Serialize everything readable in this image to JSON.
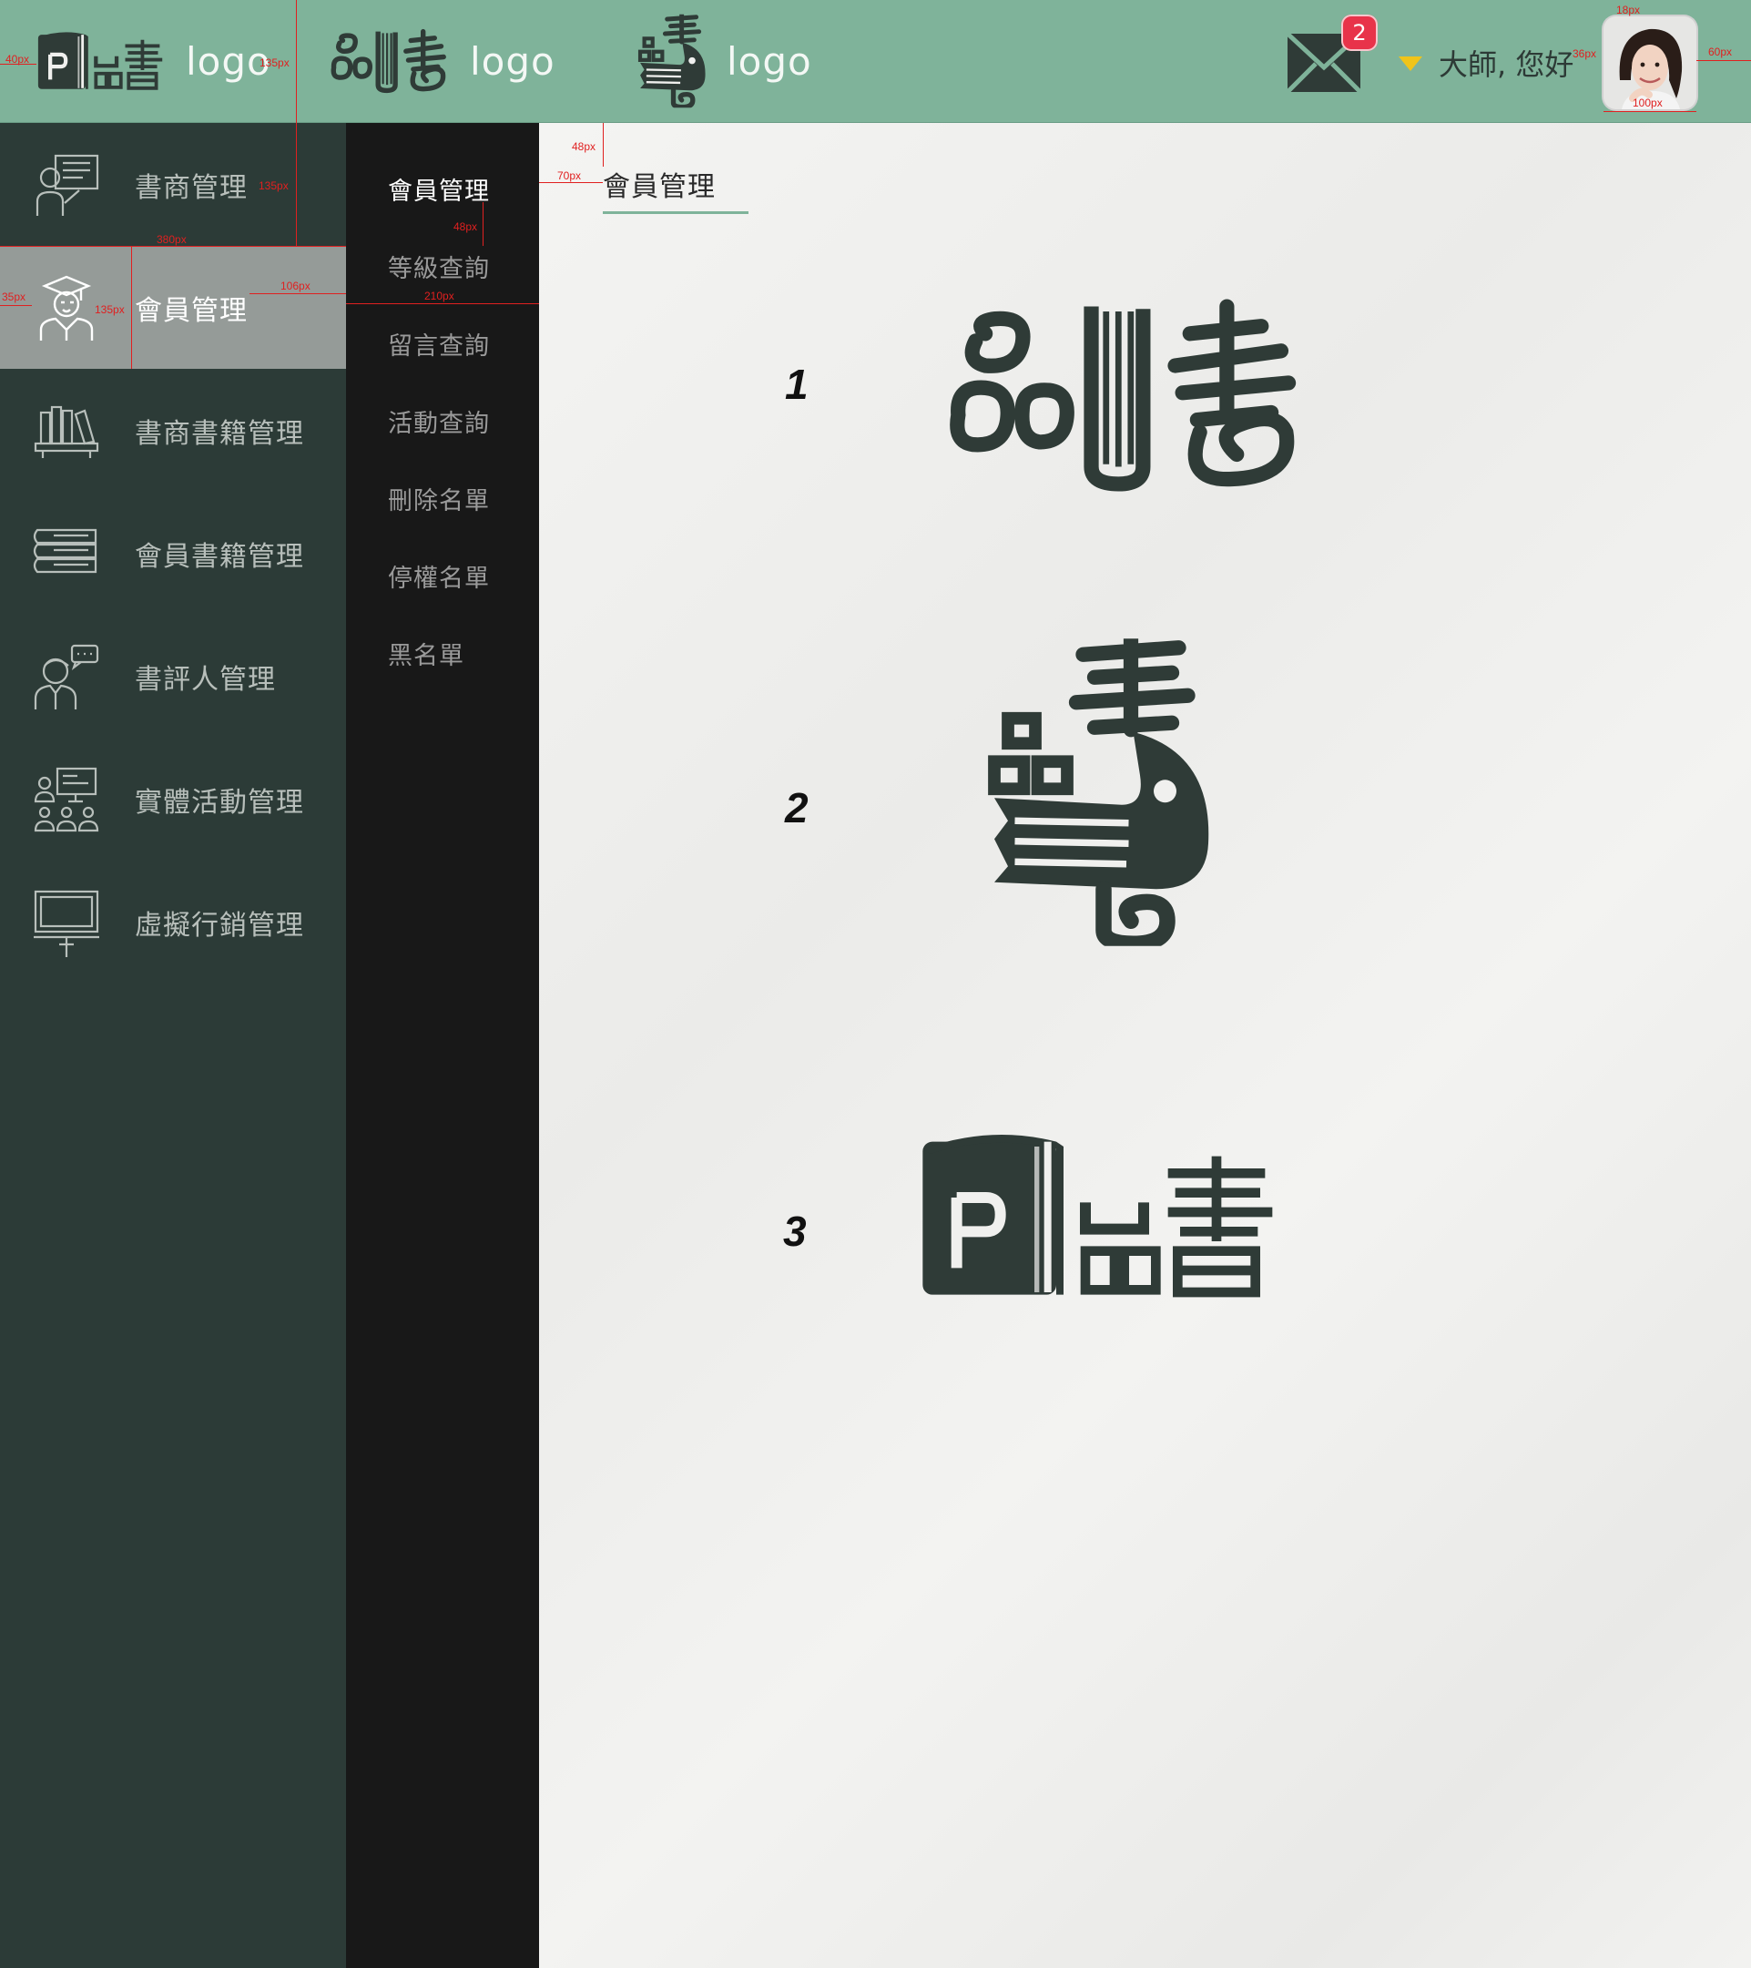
{
  "header": {
    "logos": [
      {
        "icon": "book-p-pin-shu-logo-icon",
        "text": "logo"
      },
      {
        "icon": "pin-book-shu-logo-icon",
        "text": "logo"
      },
      {
        "icon": "bird-shu-logo-icon",
        "text": "logo"
      }
    ],
    "mail_icon": "mail-icon",
    "unread_count": "2",
    "dropdown_icon": "caret-down-icon",
    "greeting": "大師, 您好",
    "avatar_icon": "user-avatar"
  },
  "sidebar": {
    "items": [
      {
        "label": "書商管理",
        "icon": "teacher-presenting-icon",
        "active": false
      },
      {
        "label": "會員管理",
        "icon": "graduate-student-icon",
        "active": true
      },
      {
        "label": "書商書籍管理",
        "icon": "bookshelf-icon",
        "active": false
      },
      {
        "label": "會員書籍管理",
        "icon": "stacked-books-icon",
        "active": false
      },
      {
        "label": "書評人管理",
        "icon": "reviewer-speech-icon",
        "active": false
      },
      {
        "label": "實體活動管理",
        "icon": "audience-presentation-icon",
        "active": false
      },
      {
        "label": "虛擬行銷管理",
        "icon": "monitor-stand-icon",
        "active": false
      }
    ]
  },
  "submenu": {
    "items": [
      {
        "label": "會員管理",
        "active": true
      },
      {
        "label": "等級查詢",
        "active": false
      },
      {
        "label": "留言查詢",
        "active": false
      },
      {
        "label": "活動查詢",
        "active": false
      },
      {
        "label": "刪除名單",
        "active": false
      },
      {
        "label": "停權名單",
        "active": false
      },
      {
        "label": "黑名單",
        "active": false
      }
    ]
  },
  "content": {
    "breadcrumb": "會員管理",
    "options": [
      {
        "number": "1",
        "logo": "pin-book-shu-logo-icon"
      },
      {
        "number": "2",
        "logo": "bird-shu-logo-icon"
      },
      {
        "number": "3",
        "logo": "book-p-pin-shu-logo-icon"
      }
    ]
  },
  "annotations": {
    "a1": "40px",
    "a2": "135px",
    "a3": "18px",
    "a4": "36px",
    "a5": "60px",
    "a6": "100px",
    "a7": "135px",
    "a8": "380px",
    "a9": "35px",
    "a10": "135px",
    "a11": "106px",
    "a12": "48px",
    "a13": "210px",
    "a14": "48px",
    "a15": "70px"
  },
  "colors": {
    "header_bg": "#7fb39a",
    "sidebar_bg": "#2c3b37",
    "sidebar_active": "#959b98",
    "submenu_bg": "#181818",
    "badge": "#e8334a",
    "caret": "#f0c419",
    "ink": "#2f3b37"
  }
}
